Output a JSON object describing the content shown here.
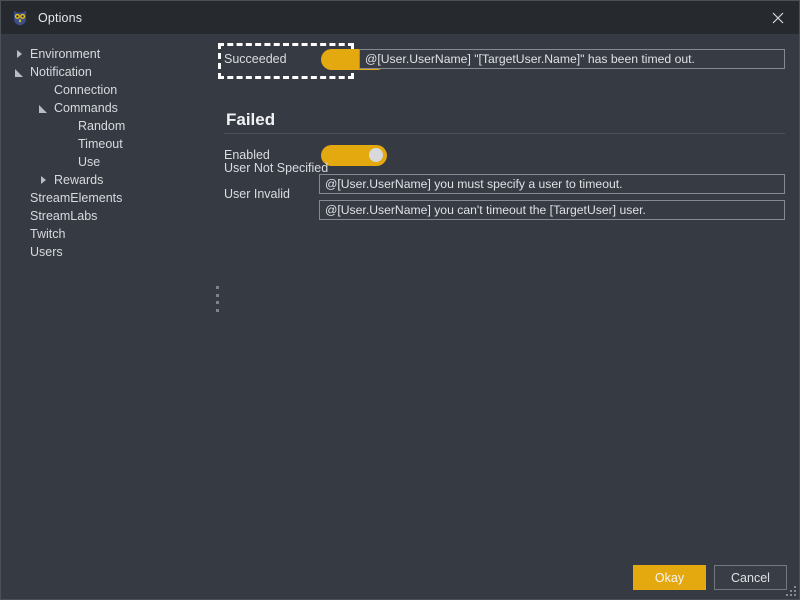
{
  "window": {
    "title": "Options",
    "app_icon": "owl-icon",
    "close_icon": "close-icon"
  },
  "sidebar": {
    "items": [
      {
        "label": "Environment",
        "depth": 0,
        "arrow": "collapsed"
      },
      {
        "label": "Notification",
        "depth": 0,
        "arrow": "expanded"
      },
      {
        "label": "Connection",
        "depth": 1,
        "arrow": "none"
      },
      {
        "label": "Commands",
        "depth": 1,
        "arrow": "expanded"
      },
      {
        "label": "Random",
        "depth": 2,
        "arrow": "none"
      },
      {
        "label": "Timeout",
        "depth": 2,
        "arrow": "none"
      },
      {
        "label": "Use",
        "depth": 2,
        "arrow": "none"
      },
      {
        "label": "Rewards",
        "depth": 1,
        "arrow": "collapsed"
      },
      {
        "label": "StreamElements",
        "depth": 0,
        "arrow": "none"
      },
      {
        "label": "StreamLabs",
        "depth": 0,
        "arrow": "none"
      },
      {
        "label": "Twitch",
        "depth": 0,
        "arrow": "none"
      },
      {
        "label": "Users",
        "depth": 0,
        "arrow": "none"
      }
    ]
  },
  "splitter": {
    "icon": "splitter-grip-icon"
  },
  "main": {
    "succeeded": {
      "label": "Succeeded",
      "toggle_on": true,
      "message": "@[User.UserName] \"[TargetUser.Name]\" has been timed out."
    },
    "failed_section": {
      "title": "Failed",
      "enabled": {
        "label": "Enabled",
        "toggle_on": true
      },
      "user_not_specified": {
        "label": "User Not Specified",
        "message": "@[User.UserName] you must specify a user to timeout."
      },
      "user_invalid": {
        "label": "User Invalid",
        "message": "@[User.UserName] you can't timeout the [TargetUser] user."
      }
    }
  },
  "footer": {
    "okay_label": "Okay",
    "cancel_label": "Cancel"
  },
  "colors": {
    "accent": "#e5a910",
    "titlebar_bg": "#26292e",
    "window_bg": "#363a42",
    "text": "#dadce0"
  }
}
